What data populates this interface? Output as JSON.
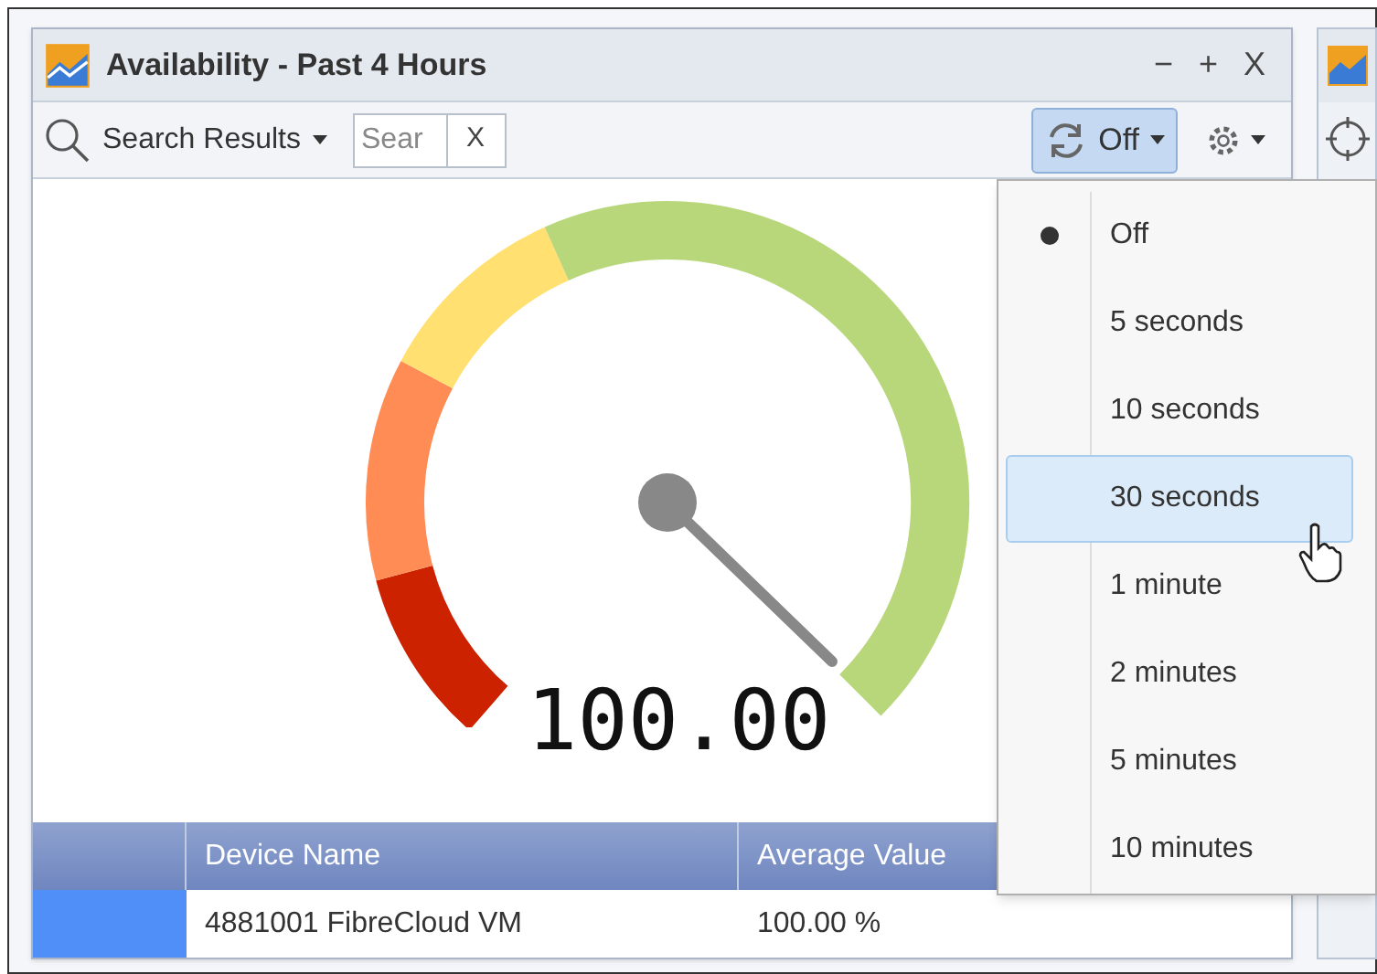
{
  "panel": {
    "title": "Availability - Past 4 Hours",
    "controls": [
      "−",
      "+",
      "X"
    ]
  },
  "toolbar": {
    "search_results": "Search Results",
    "search": {
      "placeholder": "Sear"
    },
    "clear": "X",
    "refresh": {
      "label": "Off",
      "selected": true
    }
  },
  "gauge": {
    "value": "100.00"
  },
  "table": {
    "columns": [
      "Device Name",
      "Average Value"
    ],
    "rows": [
      {
        "color": "#4f8ff7",
        "cells": [
          "4881001 FibreCloud VM",
          "100.00 %"
        ]
      }
    ]
  },
  "refresh_menu": {
    "items": [
      {
        "label": "Off",
        "selected": true,
        "highlighted": false
      },
      {
        "label": "5 seconds",
        "selected": false,
        "highlighted": false
      },
      {
        "label": "10 seconds",
        "selected": false,
        "highlighted": false
      },
      {
        "label": "30 seconds",
        "selected": false,
        "highlighted": true
      },
      {
        "label": "1 minute",
        "selected": false,
        "highlighted": false
      },
      {
        "label": "2 minutes",
        "selected": false,
        "highlighted": false
      },
      {
        "label": "5 minutes",
        "selected": false,
        "highlighted": false
      },
      {
        "label": "10 minutes",
        "selected": false,
        "highlighted": false
      }
    ]
  }
}
